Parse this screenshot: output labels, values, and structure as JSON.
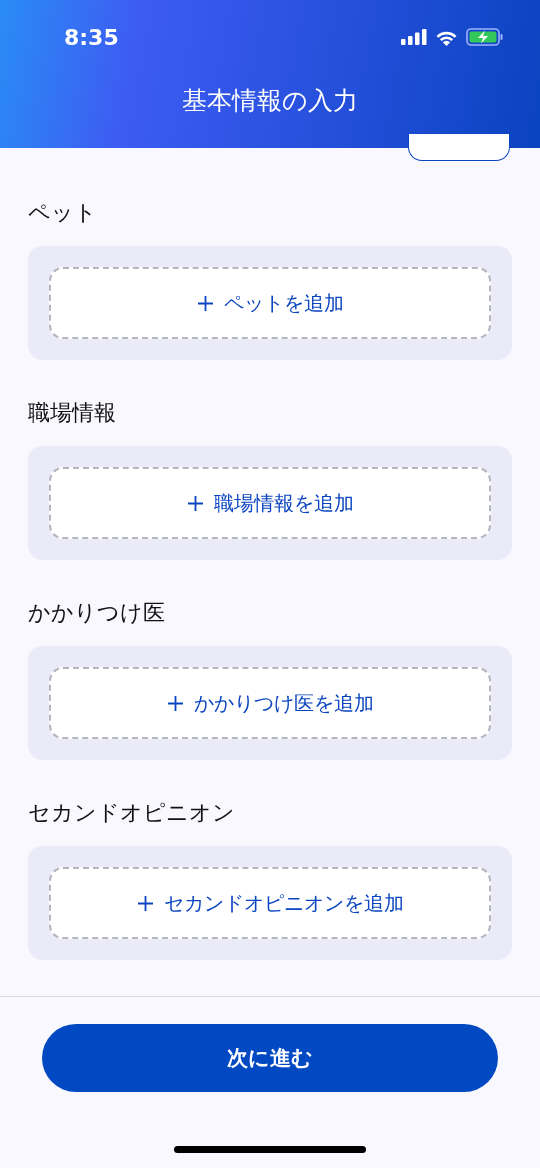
{
  "status_bar": {
    "time": "8:35"
  },
  "header": {
    "title": "基本情報の入力"
  },
  "sections": [
    {
      "title": "ペット",
      "add_label": "ペットを追加"
    },
    {
      "title": "職場情報",
      "add_label": "職場情報を追加"
    },
    {
      "title": "かかりつけ医",
      "add_label": "かかりつけ医を追加"
    },
    {
      "title": "セカンドオピニオン",
      "add_label": "セカンドオピニオンを追加"
    }
  ],
  "footer": {
    "next_button": "次に進む"
  }
}
